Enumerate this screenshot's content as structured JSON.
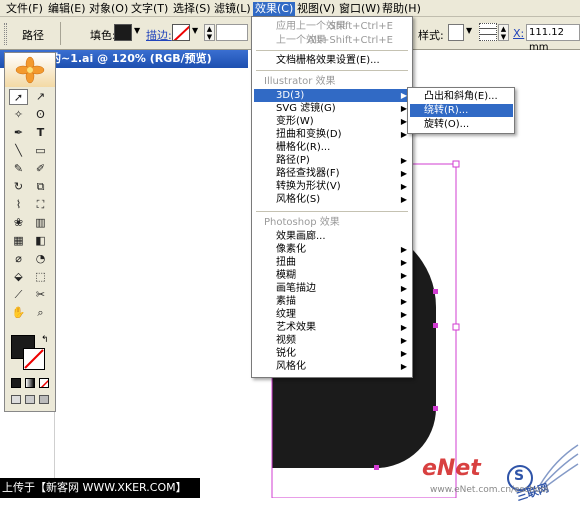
{
  "menubar": [
    "文件(F)",
    "编辑(E)",
    "对象(O)",
    "文字(T)",
    "选择(S)",
    "滤镜(L)",
    "效果(C)",
    "视图(V)",
    "窗口(W)",
    "帮助(H)"
  ],
  "control": {
    "path_label": "路径",
    "fill_label": "填色:",
    "stroke_label": "描边:",
    "style_label": "样式:",
    "x_label": "X:",
    "x_value": "111.12 mm"
  },
  "document": {
    "tab_title": "的~1.ai @ 120% (RGB/预览)"
  },
  "effects_menu": {
    "apply_last": {
      "label": "应用上一个效果",
      "shortcut": "Shift+Ctrl+E"
    },
    "last": {
      "label": "上一个效果",
      "shortcut": "Alt+Shift+Ctrl+E"
    },
    "raster_settings": "文档栅格效果设置(E)...",
    "illustrator_header": "Illustrator 效果",
    "illustrator_items": [
      "3D(3)",
      "SVG 滤镜(G)",
      "变形(W)",
      "扭曲和变换(D)",
      "栅格化(R)...",
      "路径(P)",
      "路径查找器(F)",
      "转换为形状(V)",
      "风格化(S)"
    ],
    "photoshop_header": "Photoshop 效果",
    "photoshop_items": [
      "效果画廊...",
      "像素化",
      "扭曲",
      "模糊",
      "画笔描边",
      "素描",
      "纹理",
      "艺术效果",
      "视频",
      "锐化",
      "风格化"
    ]
  },
  "submenu_3d": [
    "凸出和斜角(E)...",
    "绕转(R)...",
    "旋转(O)..."
  ],
  "footer": "上传于【新客网 WWW.XKER.COM】",
  "watermark": {
    "brand": "eNet",
    "domain": "www.eNet.com.cn/eschool",
    "logo_text": "S",
    "logo_cn": "三联网"
  },
  "colors": {
    "menu_highlight": "#316ac5",
    "shape_fill": "#1b1b1b",
    "selection": "#d23cd2",
    "chrome": "#ece9d8"
  }
}
